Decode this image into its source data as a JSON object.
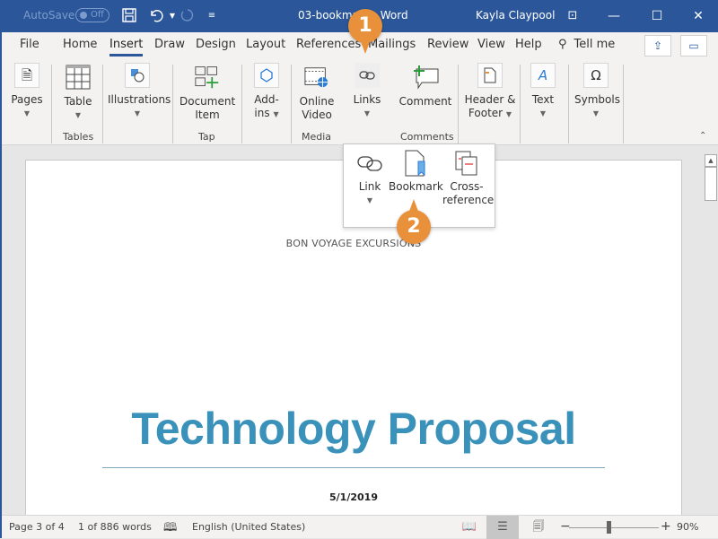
{
  "titlebar": {
    "autosave_label": "AutoSave",
    "autosave_state": "Off",
    "document_title": "03-bookmark - Word",
    "user_name": "Kayla Claypool"
  },
  "tabs": [
    {
      "label": "File"
    },
    {
      "label": "Home"
    },
    {
      "label": "Insert",
      "active": true
    },
    {
      "label": "Draw"
    },
    {
      "label": "Design"
    },
    {
      "label": "Layout"
    },
    {
      "label": "References"
    },
    {
      "label": "Mailings"
    },
    {
      "label": "Review"
    },
    {
      "label": "View"
    },
    {
      "label": "Help"
    }
  ],
  "tell_me": "Tell me",
  "ribbon": {
    "pages": "Pages",
    "table": "Table",
    "illustrations": "Illustrations",
    "document_item_1": "Document",
    "document_item_2": "Item",
    "addins_1": "Add-",
    "addins_2": "ins",
    "online_video_1": "Online",
    "online_video_2": "Video",
    "links": "Links",
    "comment": "Comment",
    "header_footer_1": "Header &",
    "header_footer_2": "Footer",
    "text": "Text",
    "symbols": "Symbols",
    "groups": {
      "tables": "Tables",
      "tap": "Tap",
      "media": "Media",
      "comments": "Comments"
    }
  },
  "links_dropdown": {
    "link": "Link",
    "bookmark": "Bookmark",
    "cross_ref_1": "Cross-",
    "cross_ref_2": "reference"
  },
  "document": {
    "header": "BON VOYAGE EXCURSIONS",
    "title": "Technology Proposal",
    "date": "5/1/2019"
  },
  "status": {
    "page": "Page 3 of 4",
    "words": "1 of 886 words",
    "language": "English (United States)",
    "zoom": "90%",
    "zoom_level_percent": 90
  },
  "callouts": {
    "step1": "1",
    "step2": "2"
  },
  "colors": {
    "brand": "#2b579a",
    "callout": "#e8913a",
    "title": "#3a92ba"
  }
}
